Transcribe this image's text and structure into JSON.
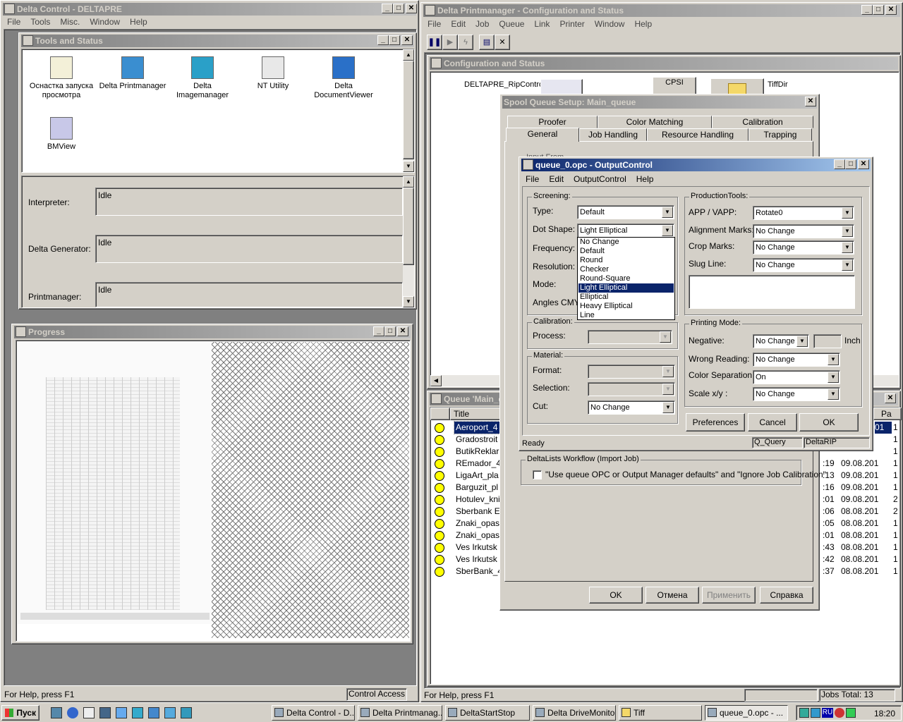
{
  "delta_control": {
    "title": "Delta Control - DELTAPRE",
    "menu": [
      "File",
      "Tools",
      "Misc.",
      "Window",
      "Help"
    ],
    "status_left": "For Help, press F1",
    "status_right": "Control Access"
  },
  "tools": {
    "title": "Tools and Status",
    "icons": [
      {
        "label": "Оснастка запуска просмотра",
        "icon": "snapin-icon"
      },
      {
        "label": "Delta Printmanager",
        "icon": "printmanager-icon"
      },
      {
        "label": "Delta Imagemanager",
        "icon": "imagemanager-icon"
      },
      {
        "label": "NT Utility",
        "icon": "nt-utility-icon"
      },
      {
        "label": "Delta DocumentViewer",
        "icon": "documentviewer-icon"
      },
      {
        "label": "BMView",
        "icon": "bmview-icon"
      }
    ],
    "status_rows": [
      {
        "label": "Interpreter:",
        "value": "Idle"
      },
      {
        "label": "Delta Generator:",
        "value": "Idle"
      },
      {
        "label": "Printmanager:",
        "value": "Idle"
      }
    ]
  },
  "progress": {
    "title": "Progress"
  },
  "printmanager": {
    "title": "Delta Printmanager - Configuration and Status",
    "menu": [
      "File",
      "Edit",
      "Job",
      "Queue",
      "Link",
      "Printer",
      "Window",
      "Help"
    ],
    "status_left": "For Help, press F1",
    "jobs_total": "Jobs Total: 13"
  },
  "config": {
    "title": "Configuration and Status",
    "rip_label": "DELTAPRE_RipControl",
    "cpsi_label": "CPSI",
    "tiffdir_label": "TiffDir"
  },
  "queue": {
    "title": "Queue 'Main_q",
    "col_title": "Title",
    "col_pa": "Pa",
    "jobs": [
      {
        "title": "Aeroport_4",
        "time": "",
        "date": "",
        "pa": "1"
      },
      {
        "title": "Gradostroit",
        "time": "",
        "date": "",
        "pa": "1"
      },
      {
        "title": "ButikReklar",
        "time": "",
        "date": "",
        "pa": "1"
      },
      {
        "title": "REmador_4",
        "time": ":19",
        "date": "09.08.201",
        "pa": "1"
      },
      {
        "title": "LigaArt_pla",
        "time": ":13",
        "date": "09.08.201",
        "pa": "1"
      },
      {
        "title": "Barguzit_pl",
        "time": ":16",
        "date": "09.08.201",
        "pa": "1"
      },
      {
        "title": "Hotulev_kni",
        "time": ":01",
        "date": "09.08.201",
        "pa": "2"
      },
      {
        "title": "Sberbank E",
        "time": ":06",
        "date": "08.08.201",
        "pa": "2"
      },
      {
        "title": "Znaki_opas",
        "time": ":05",
        "date": "08.08.201",
        "pa": "1"
      },
      {
        "title": "Znaki_opas",
        "time": ":01",
        "date": "08.08.201",
        "pa": "1"
      },
      {
        "title": "Ves Irkutsk",
        "time": ":43",
        "date": "08.08.201",
        "pa": "1"
      },
      {
        "title": "Ves Irkutsk",
        "time": ":42",
        "date": "08.08.201",
        "pa": "1"
      },
      {
        "title": "SberBank_4",
        "time": ":37",
        "date": "08.08.201",
        "pa": "1"
      }
    ],
    "first_row_date": "01"
  },
  "spool": {
    "title": "Spool Queue Setup: Main_queue",
    "tabs_back": [
      "Proofer",
      "Color Matching",
      "Calibration"
    ],
    "tabs_front": [
      "General",
      "Job Handling",
      "Resource Handling",
      "Trapping"
    ],
    "input_from": "Input From",
    "workflow_group": "DeltaLists Workflow (Import Job)",
    "workflow_check": "\"Use queue OPC or Output Manager defaults\" and \"Ignore Job Calibration\"",
    "buttons": {
      "ok": "OK",
      "cancel": "Отмена",
      "apply": "Применить",
      "help": "Справка"
    }
  },
  "output": {
    "title": "queue_0.opc - OutputControl",
    "menu": [
      "File",
      "Edit",
      "OutputControl",
      "Help"
    ],
    "screening": {
      "group": "Screening:",
      "type_label": "Type:",
      "type_value": "Default",
      "dot_label": "Dot Shape:",
      "dot_value": "Light Elliptical",
      "freq_label": "Frequency:",
      "res_label": "Resolution:",
      "mode_label": "Mode:",
      "angles_label": "Angles CMYK"
    },
    "dot_options": [
      "No Change",
      "Default",
      "Round",
      "Checker",
      "Round-Square",
      "Light Elliptical",
      "Elliptical",
      "Heavy Elliptical",
      "Line"
    ],
    "dot_selected": "Light Elliptical",
    "calibration": {
      "group": "Calibration:",
      "process_label": "Process:"
    },
    "material": {
      "group": "Material:",
      "format_label": "Format:",
      "selection_label": "Selection:",
      "cut_label": "Cut:",
      "cut_value": "No Change"
    },
    "production": {
      "group": "ProductionTools:",
      "app_label": "APP / VAPP:",
      "app_value": "Rotate0",
      "align_label": "Alignment Marks:",
      "align_value": "No Change",
      "crop_label": "Crop Marks:",
      "crop_value": "No Change",
      "slug_label": "Slug Line:",
      "slug_value": "No Change"
    },
    "printing": {
      "group": "Printing Mode:",
      "neg_label": "Negative:",
      "neg_value": "No Change",
      "inch": "Inch",
      "wrong_label": "Wrong Reading:",
      "wrong_value": "No Change",
      "sep_label": "Color Separation:",
      "sep_value": "On",
      "scale_label": "Scale x/y :",
      "scale_value": "No Change"
    },
    "buttons": {
      "prefs": "Preferences",
      "cancel": "Cancel",
      "ok": "OK"
    },
    "status": {
      "ready": "Ready",
      "query": "Q_Query",
      "rip": "DeltaRIP"
    }
  },
  "taskbar": {
    "start": "Пуск",
    "tasks": [
      "Delta Control - D...",
      "Delta Printmanag...",
      "DeltaStartStop",
      "Delta DriveMonitor",
      "Tiff",
      "queue_0.opc - ..."
    ],
    "lang": "RU",
    "clock": "18:20"
  }
}
